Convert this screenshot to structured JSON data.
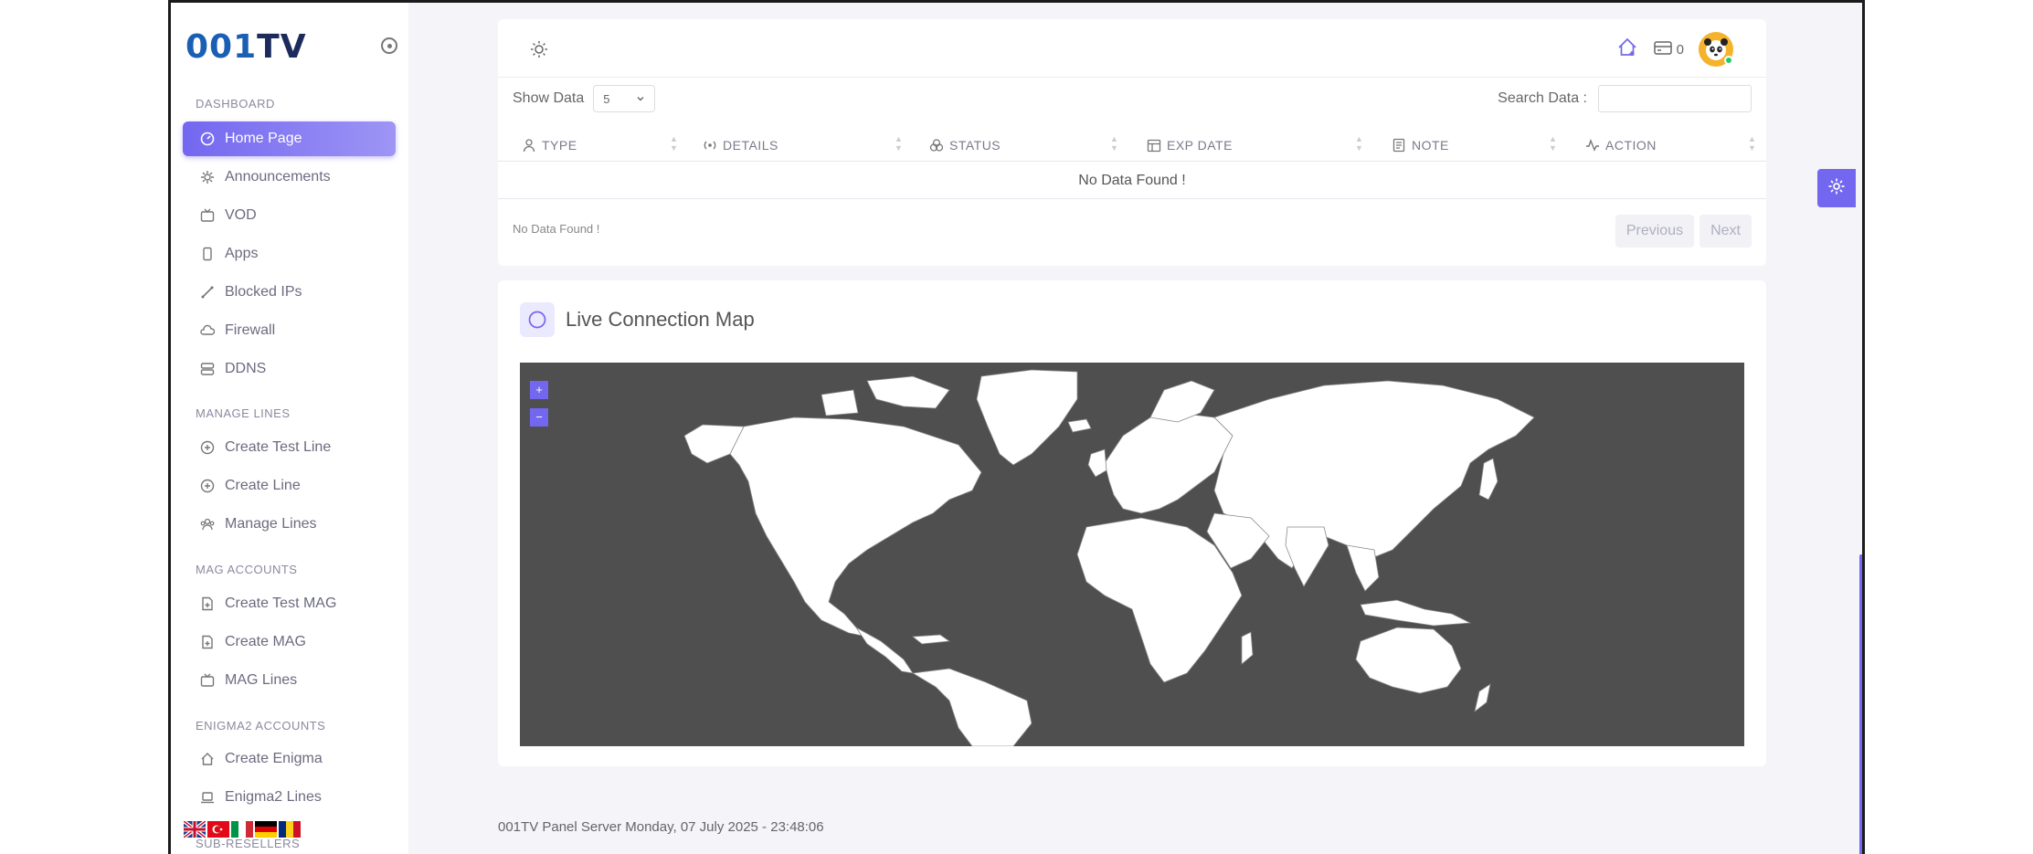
{
  "brand": {
    "logo_part1": "001",
    "logo_part2": "TV"
  },
  "sidebar": {
    "sections": [
      {
        "title": "DASHBOARD",
        "items": [
          {
            "label": "Home Page",
            "icon": "dashboard-icon",
            "active": true
          },
          {
            "label": "Announcements",
            "icon": "announcement-icon"
          },
          {
            "label": "VOD",
            "icon": "tv-icon"
          },
          {
            "label": "Apps",
            "icon": "phone-icon"
          },
          {
            "label": "Blocked IPs",
            "icon": "blocked-icon"
          },
          {
            "label": "Firewall",
            "icon": "cloud-icon"
          },
          {
            "label": "DDNS",
            "icon": "server-icon"
          }
        ]
      },
      {
        "title": "MANAGE LINES",
        "items": [
          {
            "label": "Create Test Line",
            "icon": "plus-circle-icon"
          },
          {
            "label": "Create Line",
            "icon": "plus-circle-icon"
          },
          {
            "label": "Manage Lines",
            "icon": "users-icon"
          }
        ]
      },
      {
        "title": "MAG ACCOUNTS",
        "items": [
          {
            "label": "Create Test MAG",
            "icon": "file-plus-icon"
          },
          {
            "label": "Create MAG",
            "icon": "file-plus-icon"
          },
          {
            "label": "MAG Lines",
            "icon": "tv-icon"
          }
        ]
      },
      {
        "title": "ENIGMA2 ACCOUNTS",
        "items": [
          {
            "label": "Create Enigma",
            "icon": "home-plus-icon"
          },
          {
            "label": "Enigma2 Lines",
            "icon": "laptop-icon"
          }
        ]
      },
      {
        "title": "SUB-RESELLERS",
        "items": []
      }
    ]
  },
  "header": {
    "wallet_count": "0"
  },
  "table": {
    "show_data_label": "Show Data",
    "page_size": "5",
    "search_label": "Search Data :",
    "search_value": "",
    "columns": [
      "TYPE",
      "DETAILS",
      "STATUS",
      "EXP DATE",
      "NOTE",
      "ACTION"
    ],
    "empty_message": "No Data Found !",
    "info_text": "No Data Found !",
    "prev_label": "Previous",
    "next_label": "Next"
  },
  "map": {
    "title": "Live Connection Map",
    "zoom_in": "+",
    "zoom_out": "−",
    "background_color": "#4f4f4f",
    "land_color": "#ffffff"
  },
  "footer": {
    "text": "001TV Panel Server Monday, 07 July 2025 - 23:48:06"
  },
  "colors": {
    "accent": "#7367f0",
    "online": "#28c76f"
  }
}
